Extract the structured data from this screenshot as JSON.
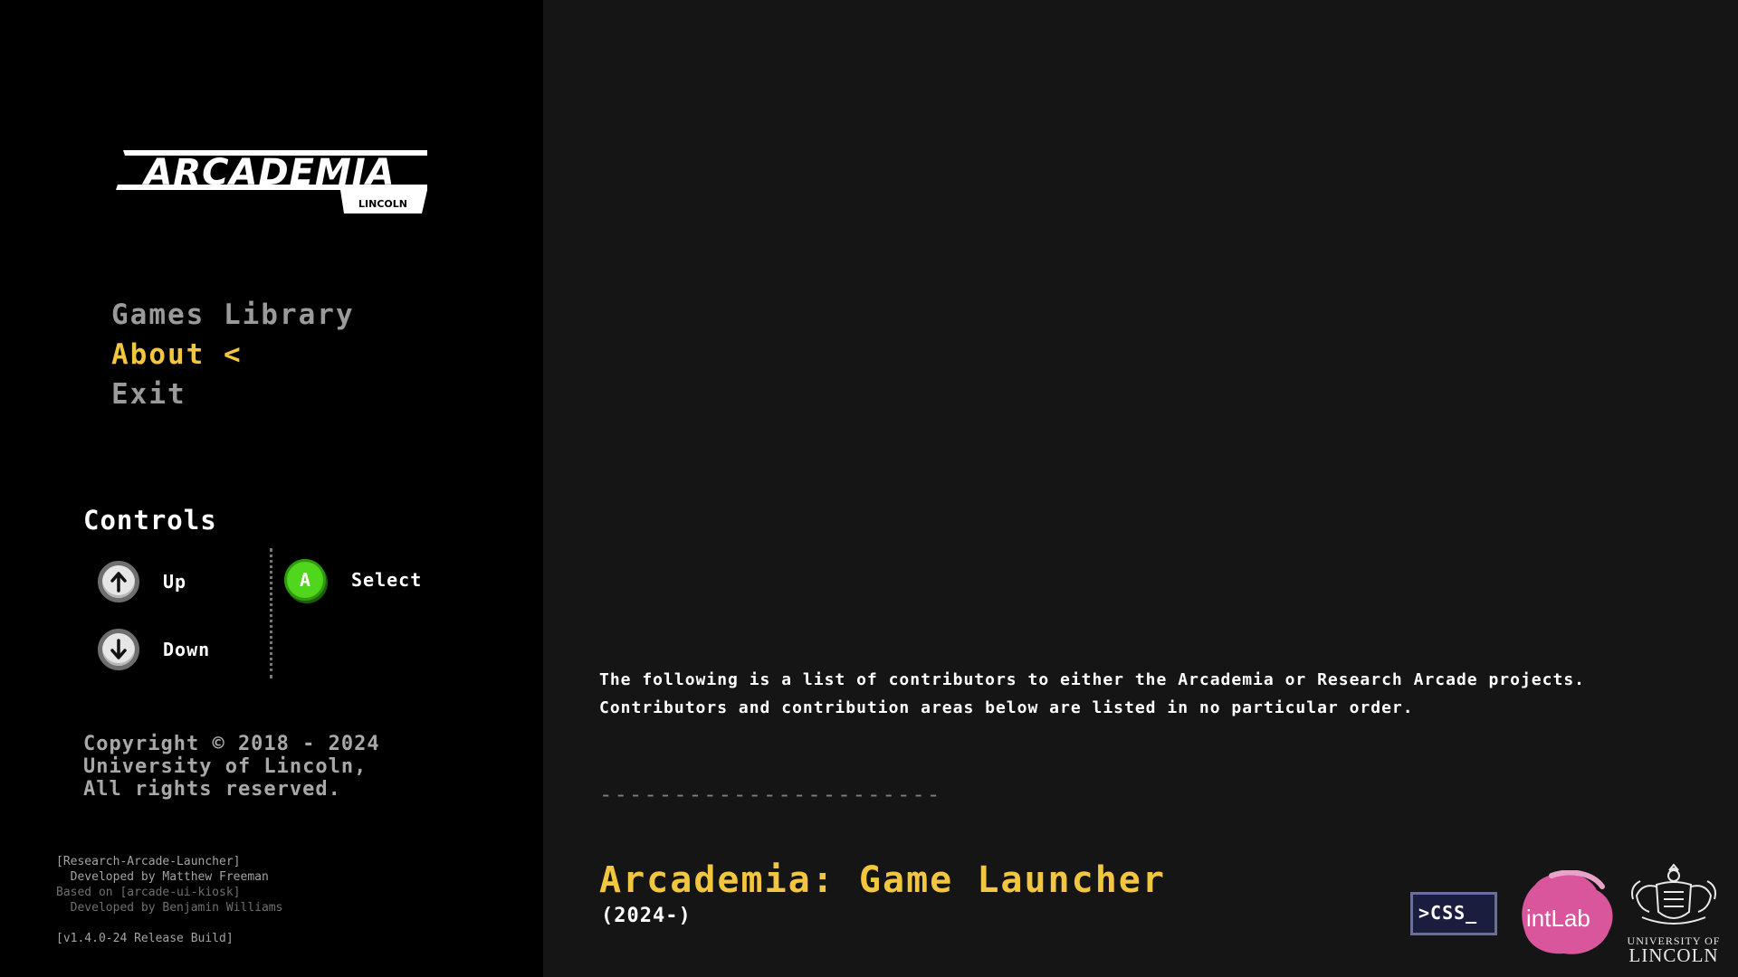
{
  "brand": {
    "name": "ARCADEMIA",
    "sub": "LINCOLN"
  },
  "menu": {
    "items": [
      {
        "label": "Games Library"
      },
      {
        "label": "About <"
      },
      {
        "label": "Exit"
      }
    ],
    "active_index": 1
  },
  "controls": {
    "title": "Controls",
    "up": "Up",
    "down": "Down",
    "select_key": "A",
    "select": "Select"
  },
  "copyright": {
    "line1": "Copyright © 2018 - 2024",
    "line2": "University of Lincoln,",
    "line3": "All rights reserved."
  },
  "build": {
    "line1": "[Research-Arcade-Launcher]",
    "line2": "  Developed by Matthew Freeman",
    "line3": "Based on [arcade-ui-kiosk]",
    "line4": "  Developed by Benjamin Williams",
    "line5": "[v1.4.0-24 Release Build]"
  },
  "about": {
    "intro": "The following is a list of contributors to either the Arcademia or Research Arcade projects. Contributors and contribution areas below are listed in no particular order.",
    "separator": "-----------------------",
    "project_title": "Arcademia: Game Launcher",
    "project_years": "(2024-)"
  },
  "partners": {
    "css_label": ">CSS_",
    "intlab_label": "intLab",
    "uol_line1": "UNIVERSITY OF",
    "uol_line2": "LINCOLN"
  },
  "colors": {
    "accent": "#f3c63f",
    "sidebar_bg": "#000000",
    "main_bg": "#151515",
    "select_button": "#4fd61d",
    "intlab": "#d9559c"
  },
  "icons": {
    "up": "arrow-up-icon",
    "down": "arrow-down-icon",
    "select": "a-button-icon"
  }
}
